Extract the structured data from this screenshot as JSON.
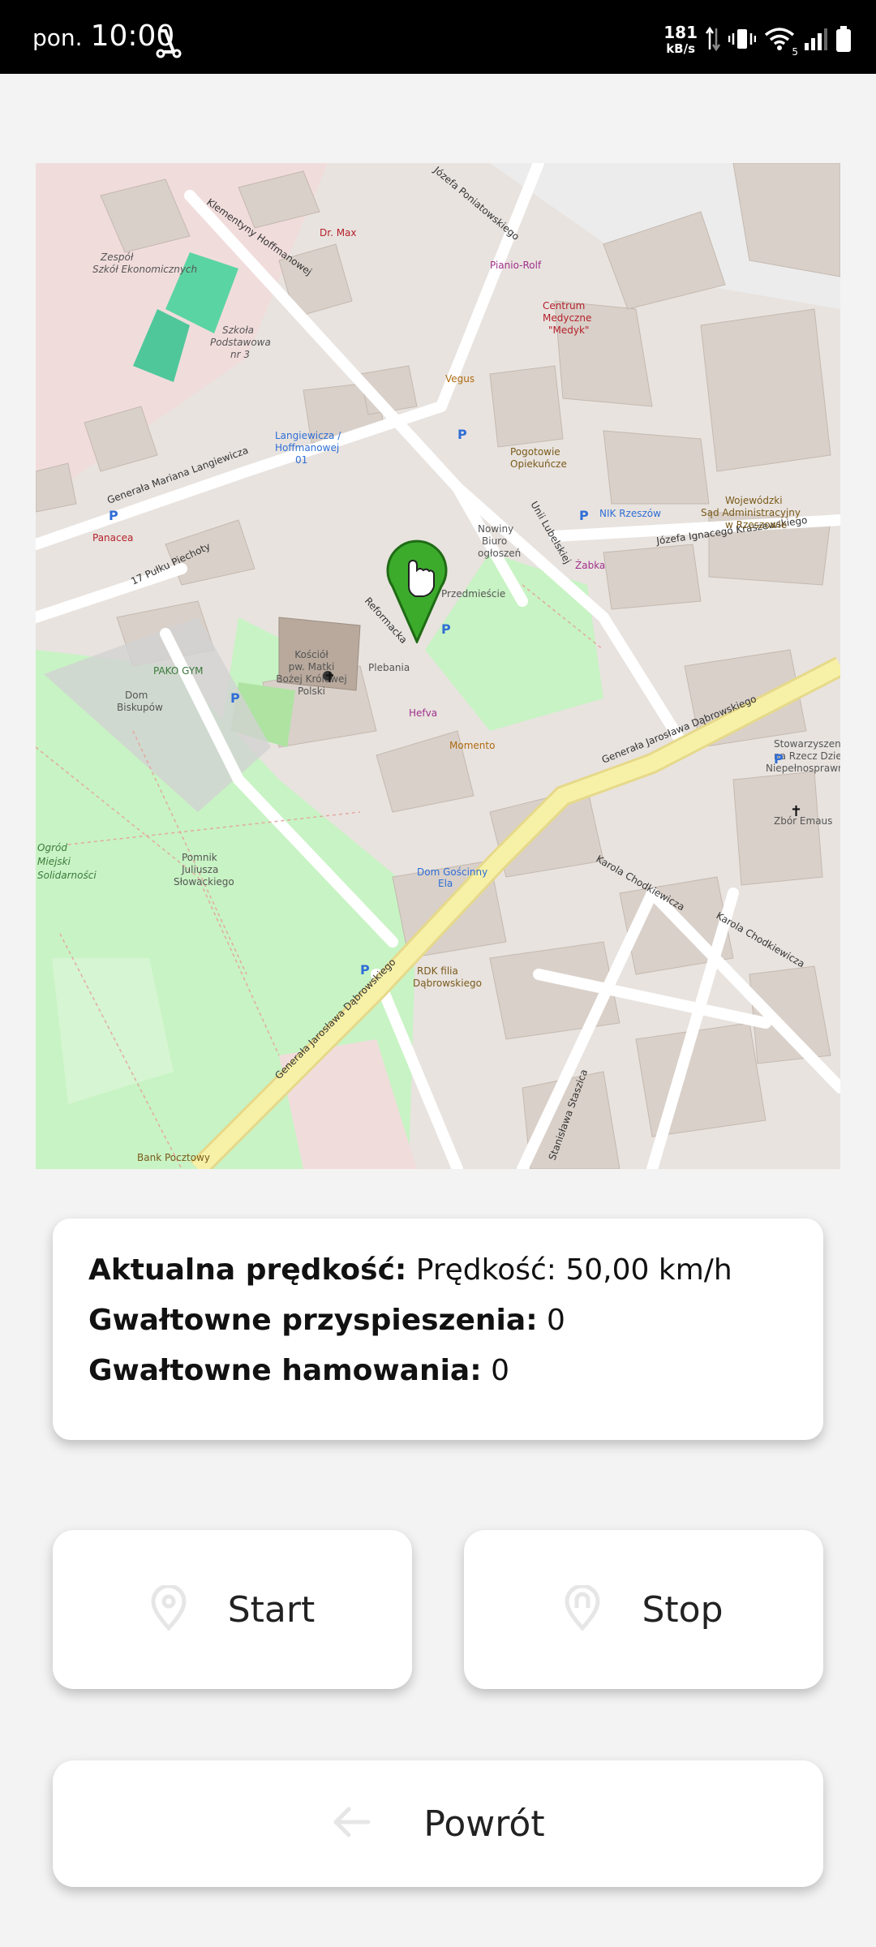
{
  "status_bar": {
    "day": "pon.",
    "time": "10:00",
    "net_speed_value": "181",
    "net_speed_unit": "kB/s",
    "wifi_badge": "5"
  },
  "map": {
    "streets": [
      "Generała Mariana Langiewicza",
      "17 Pułku Piechoty",
      "Reformacka",
      "Generała Jarosława Dąbrowskiego",
      "Karola Chodkiewicza",
      "Józefa Ignacego Kraszewskiego",
      "Unii Lubelskiej",
      "Klementyny Hoffmanowej",
      "Józefa Poniatowskiego",
      "Stanisława Staszica"
    ],
    "places": [
      "Kościół pw. Matki Bożej Królowej Polski",
      "Plebania",
      "Hefva",
      "Momento",
      "Dom Gościnny Ela",
      "Pomnik Juliusza Słowackiego",
      "Ogród Miejski Solidarności",
      "Dom Biskupów",
      "PAKO GYM",
      "Zbór Emaus",
      "Szkoła Podstawowa nr 3",
      "Zespół Szkół Ekonomicznych",
      "Centrum Medyczne Medyk",
      "Pogotowie Opiekuńcze",
      "Wojewódzki Sąd Administracyjny w Rzeszowie",
      "Żabka",
      "Vegus",
      "Dr. Max",
      "Pianio-Rolf",
      "RDK filia Dąbrowskiego",
      "Bank Pocztowy",
      "Panacea",
      "NIK Rzeszów",
      "Langiewicza / Hoffmanowej 01",
      "Nowiny Biuro ogłoszeń",
      "Przedmieście",
      "Stowarzyszenie na Rzecz Dzieci Niepełnosprawnych"
    ]
  },
  "info": {
    "speed_label": "Aktualna prędkość:",
    "speed_value": "Prędkość: 50,00 km/h",
    "accel_label": "Gwałtowne przyspieszenia:",
    "accel_value": "0",
    "brake_label": "Gwałtowne hamowania:",
    "brake_value": "0"
  },
  "buttons": {
    "start": "Start",
    "stop": "Stop",
    "back": "Powrót"
  },
  "colors": {
    "accent_green": "#3cab2c",
    "park": "#c8f2c4",
    "road_primary": "#f7f1a8",
    "background": "#f3f3f3"
  }
}
